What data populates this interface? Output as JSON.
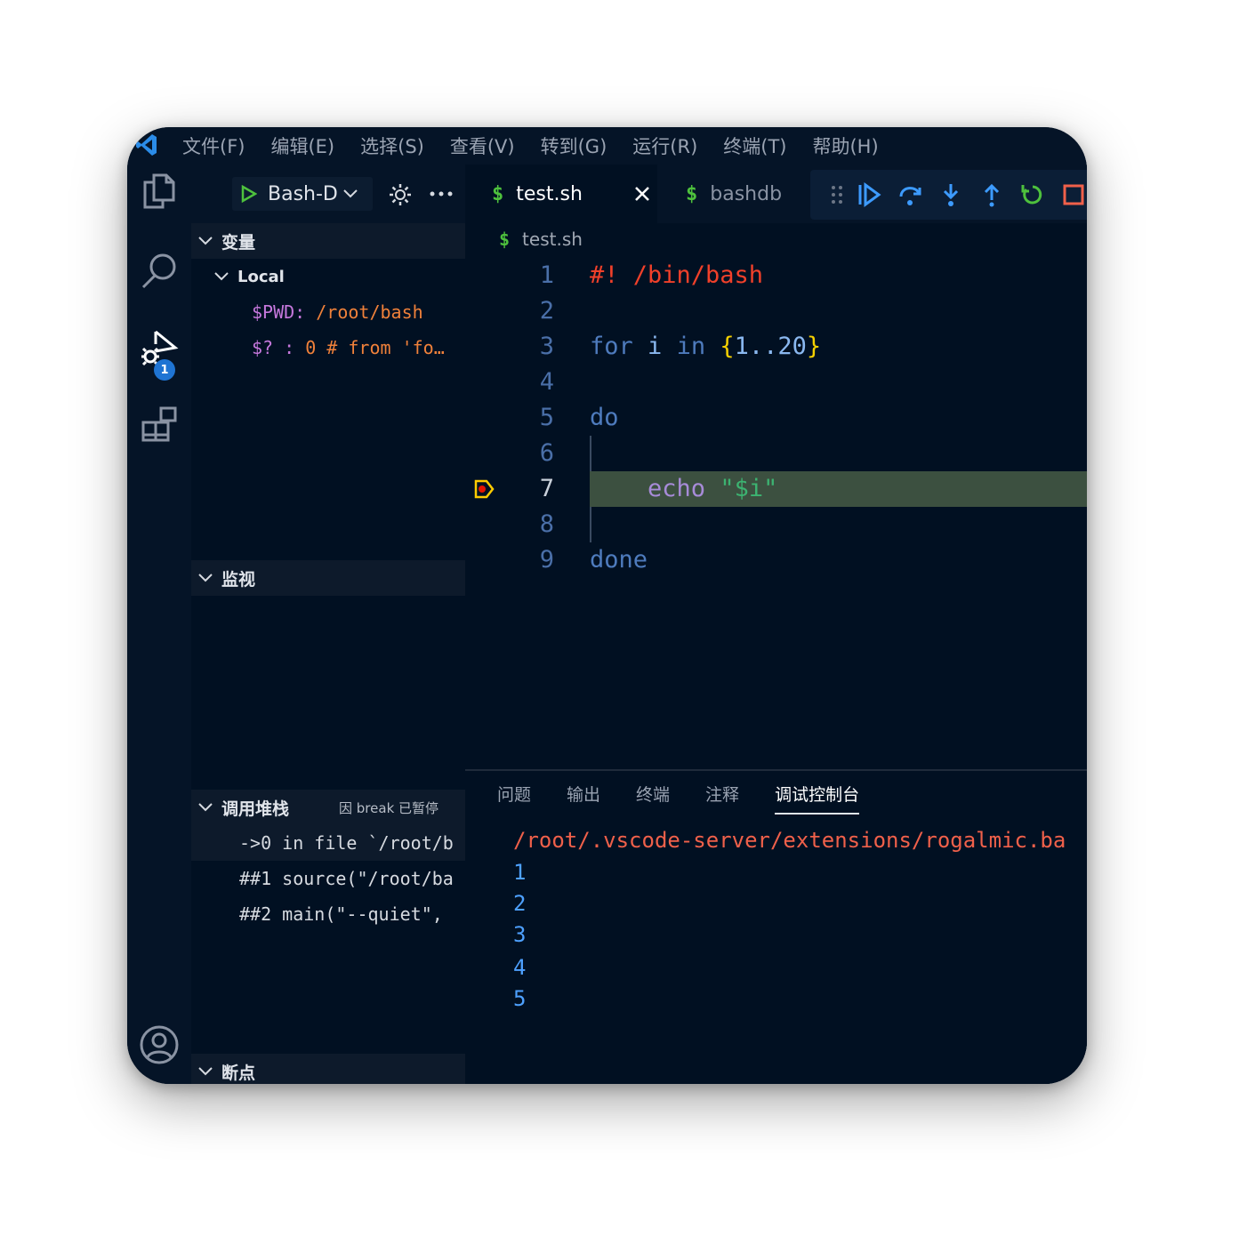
{
  "menu": [
    "文件(F)",
    "编辑(E)",
    "选择(S)",
    "查看(V)",
    "转到(G)",
    "运行(R)",
    "终端(T)",
    "帮助(H)"
  ],
  "activity": {
    "debug_badge": "1"
  },
  "sidebar": {
    "run_config": "Bash-D",
    "variables": {
      "title": "变量",
      "scope": "Local",
      "items": [
        {
          "name": "$PWD",
          "sep": ": ",
          "value": "/root/bash"
        },
        {
          "name": "$?",
          "sep": " : ",
          "value": "0 # from 'fo…"
        }
      ]
    },
    "watch": {
      "title": "监视"
    },
    "callstack": {
      "title": "调用堆栈",
      "status": "因 break 已暂停",
      "frames": [
        "->0 in file `/root/b",
        "##1 source(\"/root/ba",
        "##2 main(\"--quiet\","
      ]
    },
    "breakpoints": {
      "title": "断点"
    }
  },
  "editor": {
    "tabs": [
      {
        "label": "test.sh",
        "icon": "$",
        "active": true
      },
      {
        "label": "bashdb",
        "icon": "$",
        "active": false
      }
    ],
    "breadcrumb": "test.sh",
    "current_line": 7,
    "lines": [
      {
        "n": "1",
        "text": "#! /bin/bash"
      },
      {
        "n": "2",
        "text": ""
      },
      {
        "n": "3",
        "text": "for i in {1..20}"
      },
      {
        "n": "4",
        "text": ""
      },
      {
        "n": "5",
        "text": "do"
      },
      {
        "n": "6",
        "text": ""
      },
      {
        "n": "7",
        "text": "    echo \"$i\""
      },
      {
        "n": "8",
        "text": ""
      },
      {
        "n": "9",
        "text": "done"
      }
    ]
  },
  "panel": {
    "tabs": [
      "问题",
      "输出",
      "终端",
      "注释",
      "调试控制台"
    ],
    "active_tab": "调试控制台",
    "console": [
      "/root/.vscode-server/extensions/rogalmic.ba",
      "1",
      "2",
      "3",
      "4",
      "5"
    ]
  },
  "colors": {
    "background": "#011022",
    "bar": "#051427",
    "accent": "#1f74d3",
    "current_line": "#3c5040",
    "error": "#f0604a",
    "keyword": "#4e7bbd"
  }
}
